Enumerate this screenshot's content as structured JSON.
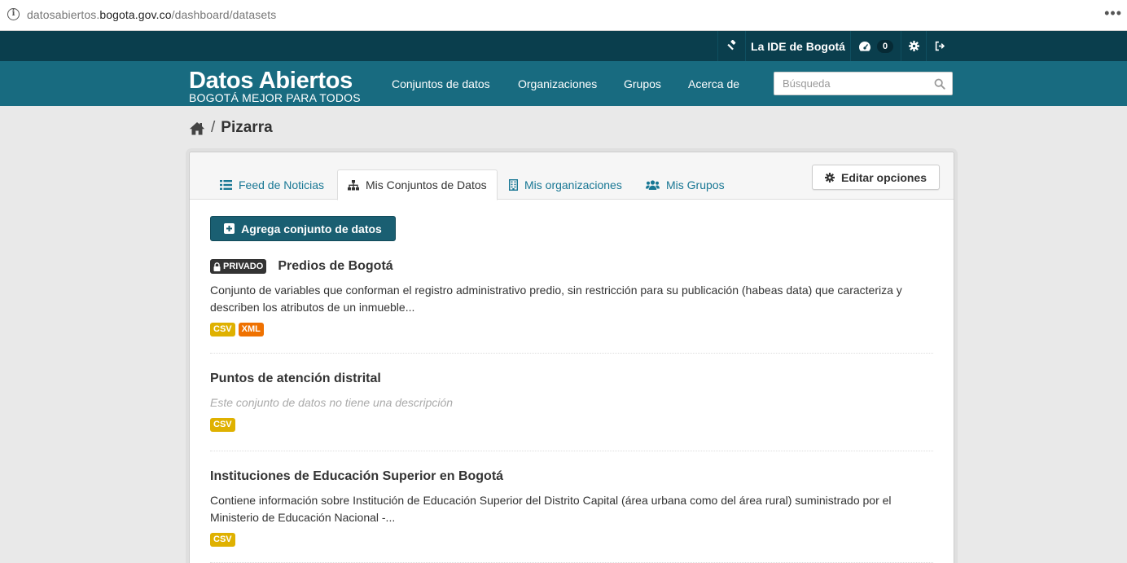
{
  "browser": {
    "url_prefix": "datosabiertos.",
    "url_host": "bogota.gov.co",
    "url_path": "/dashboard/datasets",
    "menu_glyph": "•••"
  },
  "account": {
    "admin_icon": "gavel-icon",
    "ide_label": "La IDE de Bogotá",
    "dashboard_icon": "dashboard-icon",
    "notifications_count": "0",
    "settings_icon": "gear-icon",
    "logout_icon": "sign-out-icon"
  },
  "site": {
    "title": "Datos Abiertos",
    "subtitle": "BOGOTÁ MEJOR PARA TODOS"
  },
  "nav": {
    "items": [
      {
        "label": "Conjuntos de datos"
      },
      {
        "label": "Organizaciones"
      },
      {
        "label": "Grupos"
      },
      {
        "label": "Acerca de"
      }
    ]
  },
  "search": {
    "placeholder": "Búsqueda",
    "value": ""
  },
  "breadcrumb": {
    "separator": "/",
    "current": "Pizarra"
  },
  "tabs": [
    {
      "label": "Feed de Noticias",
      "icon": "list-icon",
      "active": false
    },
    {
      "label": "Mis Conjuntos de Datos",
      "icon": "sitemap-icon",
      "active": true
    },
    {
      "label": "Mis organizaciones",
      "icon": "building-icon",
      "active": false
    },
    {
      "label": "Mis Grupos",
      "icon": "group-icon",
      "active": false
    }
  ],
  "edit_options_label": "Editar opciones",
  "add_dataset_label": "Agrega conjunto de datos",
  "datasets": [
    {
      "private_label": "PRIVADO",
      "title": "Predios de Bogotá",
      "notes": "Conjunto de variables que conforman el registro administrativo predio, sin restricción para su publicación (habeas data) que caracteriza y describen los atributos de un inmueble...",
      "formats": [
        "CSV",
        "XML"
      ]
    },
    {
      "title": "Puntos de atención distrital",
      "notes": "Este conjunto de datos no tiene una descripción",
      "formats": [
        "CSV"
      ]
    },
    {
      "title": "Instituciones de Educación Superior en Bogotá",
      "notes": "Contiene información sobre Institución de Educación Superior del Distrito Capital (área urbana como del área rural) suministrado por el Ministerio de Educación Nacional -...",
      "formats": [
        "CSV"
      ]
    }
  ],
  "colors": {
    "account_bar": "#0a3e4d",
    "navbar": "#186b80",
    "link": "#187794",
    "primary_button": "#1a5f72",
    "csv": "#dfb100",
    "xml": "#ef7100"
  }
}
